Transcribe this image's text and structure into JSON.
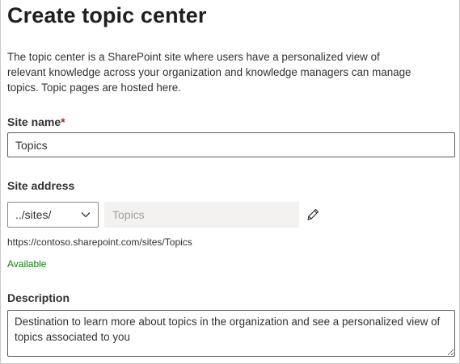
{
  "page": {
    "title": "Create topic center",
    "intro": "The topic center is a SharePoint site where users have a personalized view of relevant knowledge across your organization and knowledge managers can manage topics. Topic pages are hosted here."
  },
  "site_name": {
    "label": "Site name",
    "required_mark": "*",
    "value": "Topics"
  },
  "site_address": {
    "label": "Site address",
    "path_selected": "../sites/",
    "address_placeholder": "Topics",
    "url": "https://contoso.sharepoint.com/sites/Topics",
    "availability": "Available"
  },
  "description": {
    "label": "Description",
    "value": "Destination to learn more about topics in the organization and see a personalized view of topics associated to you"
  },
  "icons": {
    "dropdown": "chevron-down-icon",
    "edit": "pencil-icon"
  },
  "colors": {
    "required": "#a4262c",
    "available": "#107c10",
    "disabled_field_bg": "#f3f2f1"
  }
}
